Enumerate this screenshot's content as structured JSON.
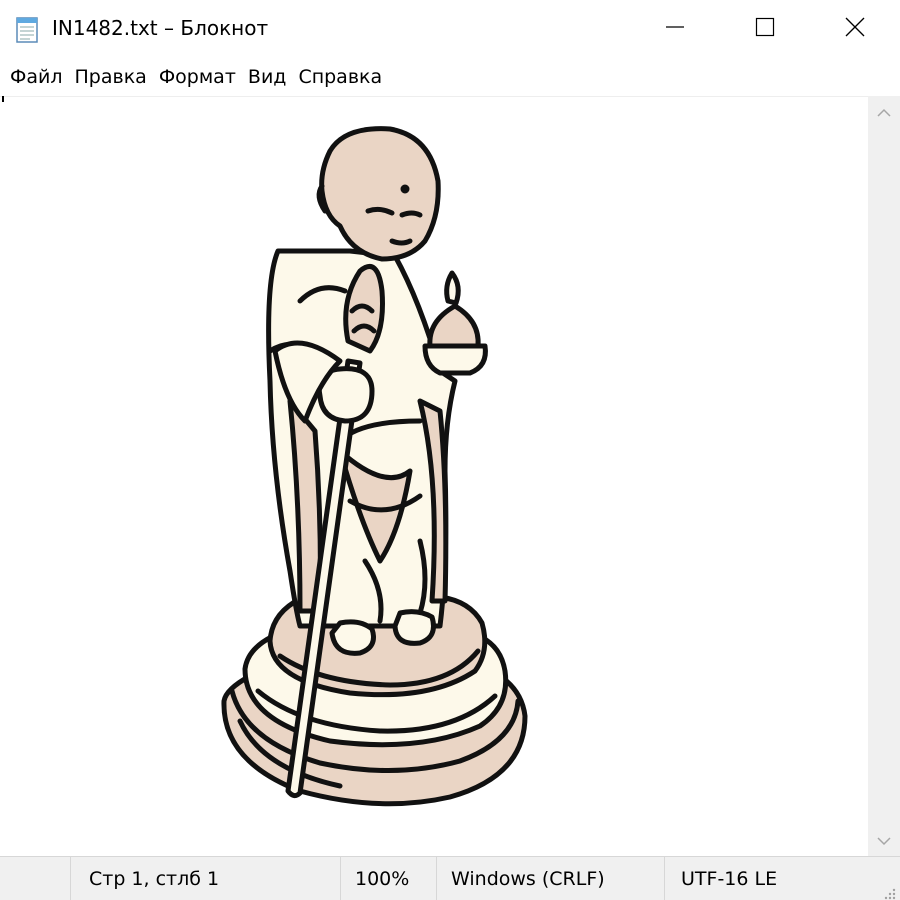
{
  "window": {
    "title": "IN1482.txt – Блокнот",
    "app_icon": "notepad-icon",
    "controls": {
      "minimize_icon": "minimize-icon",
      "maximize_icon": "maximize-icon",
      "close_icon": "close-icon"
    }
  },
  "menu": {
    "items": [
      {
        "label": "Файл"
      },
      {
        "label": "Правка"
      },
      {
        "label": "Формат"
      },
      {
        "label": "Вид"
      },
      {
        "label": "Справка"
      }
    ]
  },
  "editor": {
    "content_image": "jizo-buddhist-monk-statue-illustration",
    "scroll_up_icon": "chevron-up-icon",
    "scroll_down_icon": "chevron-down-icon"
  },
  "statusbar": {
    "position": "Стр 1, стлб 1",
    "zoom": "100%",
    "line_ending": "Windows (CRLF)",
    "encoding": "UTF-16 LE",
    "grip_icon": "resize-grip-icon"
  },
  "colors": {
    "fill_light": "#fdf9ea",
    "fill_tan": "#ead5c5",
    "outline": "#111111",
    "statusbar_bg": "#f0f0f0"
  }
}
